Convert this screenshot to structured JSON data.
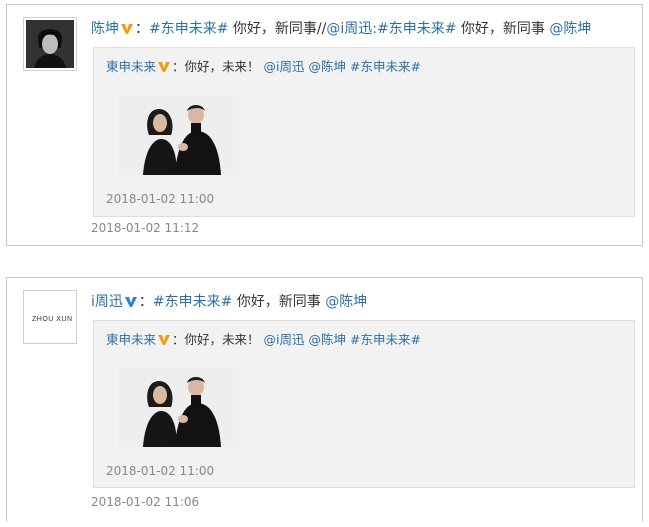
{
  "posts": [
    {
      "user": "陈坤",
      "topic": "#东申未来#",
      "text_1": "你好，新同事//",
      "mention_repost": "@i周迅",
      "topic_2": ":#东申未来#",
      "text_2": "你好，新同事",
      "mention": "@陈坤",
      "colon": "：",
      "time": "2018-01-02 11:12",
      "original": {
        "user": "東申未来",
        "colon": "：",
        "text": "你好，未来！",
        "mention_1": "@i周迅",
        "mention_2": "@陈坤",
        "topic": "#东申未来#",
        "time": "2018-01-02 11:00"
      }
    },
    {
      "user": "i周迅",
      "colon": "：",
      "topic": "#东申未来#",
      "text_1": "你好，新同事",
      "mention": "@陈坤",
      "avatar_logo": "ZHOU XUN",
      "time": "2018-01-02 11:06",
      "original": {
        "user": "東申未来",
        "colon": "：",
        "text": "你好，未来！",
        "mention_1": "@i周迅",
        "mention_2": "@陈坤",
        "topic": "#东申未来#",
        "time": "2018-01-02 11:00"
      }
    }
  ],
  "colors": {
    "link": "#2f6fa5",
    "verified_orange": "#f39c12",
    "verified_blue": "#2f7fd8",
    "repost_bg": "#f2f2f2"
  }
}
